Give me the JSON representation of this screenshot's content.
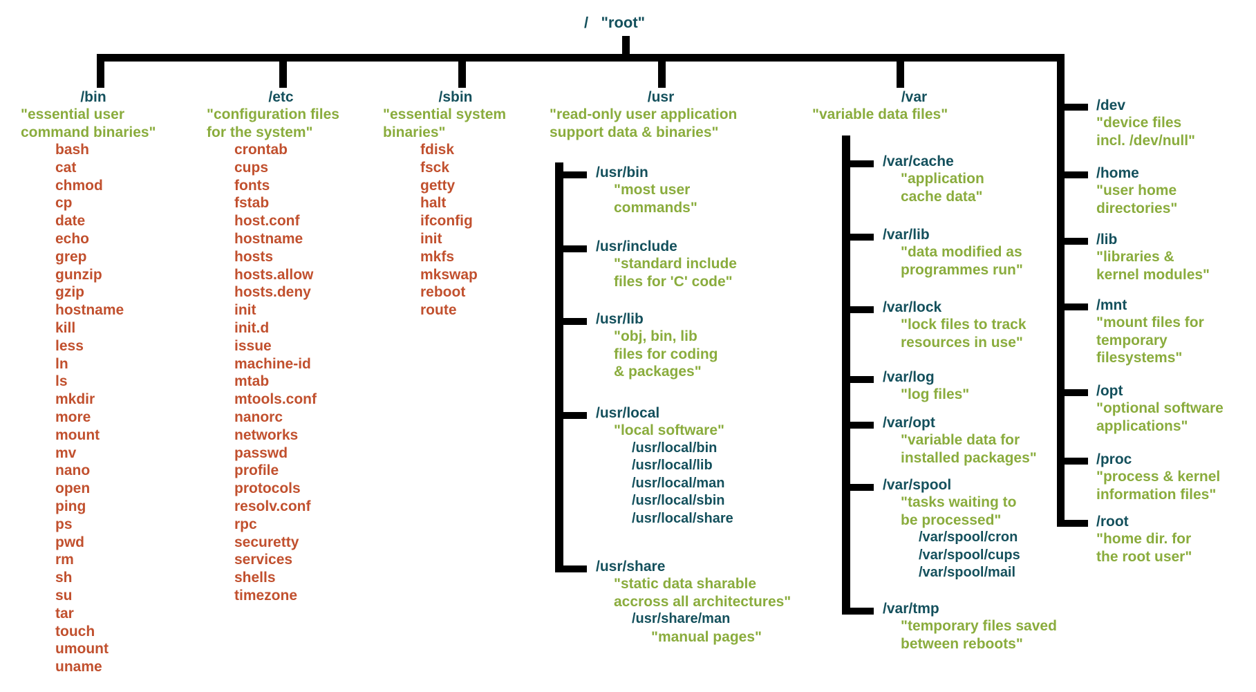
{
  "colors": {
    "dir": "#14505c",
    "desc": "#8aac3d",
    "cmd": "#c1502e",
    "line": "#000000",
    "background": "#ffffff"
  },
  "root": {
    "slash": "/",
    "label": "\"root\""
  },
  "columns": [
    {
      "name": "bin",
      "dir": "/bin",
      "desc": [
        "\"essential user",
        "command binaries\""
      ],
      "items": [
        "bash",
        "cat",
        "chmod",
        "cp",
        "date",
        "echo",
        "grep",
        "gunzip",
        "gzip",
        "hostname",
        "kill",
        "less",
        "ln",
        "ls",
        "mkdir",
        "more",
        "mount",
        "mv",
        "nano",
        "open",
        "ping",
        "ps",
        "pwd",
        "rm",
        "sh",
        "su",
        "tar",
        "touch",
        "umount",
        "uname"
      ]
    },
    {
      "name": "etc",
      "dir": "/etc",
      "desc": [
        "\"configuration files",
        "for the system\""
      ],
      "items": [
        "crontab",
        "cups",
        "fonts",
        "fstab",
        "host.conf",
        "hostname",
        "hosts",
        "hosts.allow",
        "hosts.deny",
        "init",
        "init.d",
        "issue",
        "machine-id",
        "mtab",
        "mtools.conf",
        "nanorc",
        "networks",
        "passwd",
        "profile",
        "protocols",
        "resolv.conf",
        "rpc",
        "securetty",
        "services",
        "shells",
        "timezone"
      ]
    },
    {
      "name": "sbin",
      "dir": "/sbin",
      "desc": [
        "\"essential system",
        "binaries\""
      ],
      "items": [
        "fdisk",
        "fsck",
        "getty",
        "halt",
        "ifconfig",
        "init",
        "mkfs",
        "mkswap",
        "reboot",
        "route"
      ]
    }
  ],
  "usr": {
    "dir": "/usr",
    "desc": [
      "\"read-only user application",
      "support data & binaries\""
    ],
    "children": [
      {
        "dir": "/usr/bin",
        "desc": [
          "\"most user",
          "commands\""
        ],
        "subs": []
      },
      {
        "dir": "/usr/include",
        "desc": [
          "\"standard include",
          "files for 'C' code\""
        ],
        "subs": []
      },
      {
        "dir": "/usr/lib",
        "desc": [
          "\"obj, bin, lib",
          "files for coding",
          "& packages\""
        ],
        "subs": []
      },
      {
        "dir": "/usr/local",
        "desc": [
          "\"local software\""
        ],
        "subs": [
          "/usr/local/bin",
          "/usr/local/lib",
          "/usr/local/man",
          "/usr/local/sbin",
          "/usr/local/share"
        ]
      },
      {
        "dir": "/usr/share",
        "desc": [
          "\"static data sharable",
          "accross all architectures\""
        ],
        "subs": [
          "/usr/share/man"
        ],
        "sub_desc": [
          "\"manual pages\""
        ]
      }
    ]
  },
  "var": {
    "dir": "/var",
    "desc": [
      "\"variable data files\""
    ],
    "children": [
      {
        "dir": "/var/cache",
        "desc": [
          "\"application",
          "cache data\""
        ],
        "subs": []
      },
      {
        "dir": "/var/lib",
        "desc": [
          "\"data modified as",
          "programmes run\""
        ],
        "subs": []
      },
      {
        "dir": "/var/lock",
        "desc": [
          "\"lock files to track",
          "resources in use\""
        ],
        "subs": []
      },
      {
        "dir": "/var/log",
        "desc": [
          "\"log files\""
        ],
        "subs": []
      },
      {
        "dir": "/var/opt",
        "desc": [
          "\"variable data for",
          "installed packages\""
        ],
        "subs": []
      },
      {
        "dir": "/var/spool",
        "desc": [
          "\"tasks waiting to",
          "be processed\""
        ],
        "subs": [
          "/var/spool/cron",
          "/var/spool/cups",
          "/var/spool/mail"
        ]
      },
      {
        "dir": "/var/tmp",
        "desc": [
          "\"temporary files saved",
          "between reboots\""
        ],
        "subs": []
      }
    ]
  },
  "right": {
    "children": [
      {
        "dir": "/dev",
        "desc": [
          "\"device files",
          "incl. /dev/null\""
        ]
      },
      {
        "dir": "/home",
        "desc": [
          "\"user home",
          "directories\""
        ]
      },
      {
        "dir": "/lib",
        "desc": [
          "\"libraries &",
          "kernel modules\""
        ]
      },
      {
        "dir": "/mnt",
        "desc": [
          "\"mount files for",
          "temporary",
          "filesystems\""
        ]
      },
      {
        "dir": "/opt",
        "desc": [
          "\"optional software",
          "applications\""
        ]
      },
      {
        "dir": "/proc",
        "desc": [
          "\"process & kernel",
          "information files\""
        ]
      },
      {
        "dir": "/root",
        "desc": [
          "\"home dir. for",
          "the root user\""
        ]
      }
    ]
  }
}
